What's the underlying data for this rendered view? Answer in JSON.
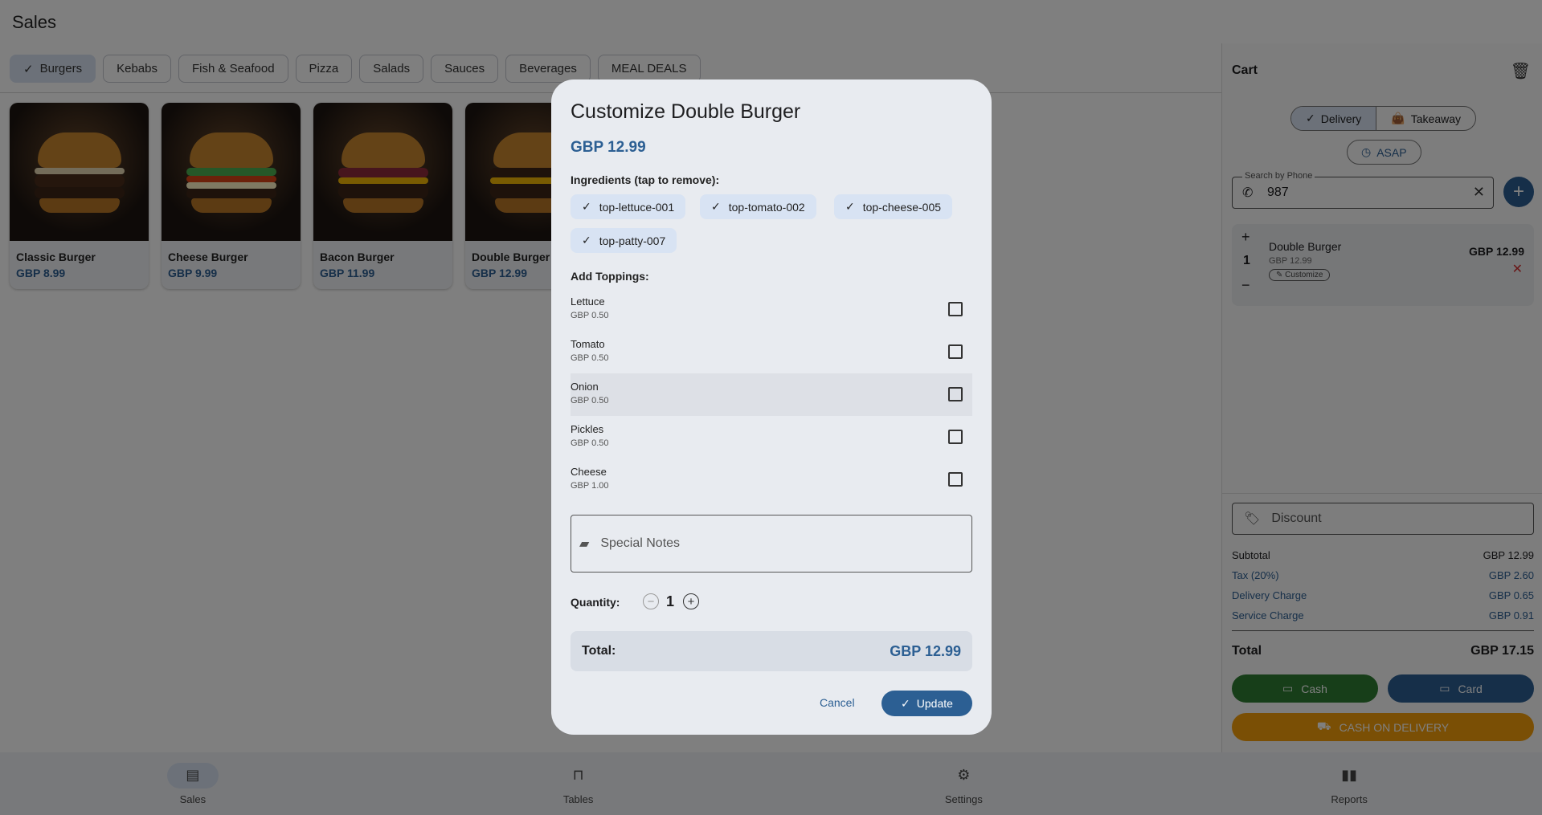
{
  "header": {
    "title": "Sales"
  },
  "categories": [
    {
      "label": "Burgers",
      "selected": true
    },
    {
      "label": "Kebabs"
    },
    {
      "label": "Fish & Seafood"
    },
    {
      "label": "Pizza"
    },
    {
      "label": "Salads"
    },
    {
      "label": "Sauces"
    },
    {
      "label": "Beverages"
    },
    {
      "label": "MEAL DEALS"
    }
  ],
  "products": [
    {
      "name": "Classic Burger",
      "price": "GBP 8.99"
    },
    {
      "name": "Cheese Burger",
      "price": "GBP 9.99"
    },
    {
      "name": "Bacon Burger",
      "price": "GBP 11.99"
    },
    {
      "name": "Double Burger",
      "price": "GBP 12.99"
    }
  ],
  "cart": {
    "title": "Cart",
    "order_types": [
      {
        "label": "Delivery",
        "selected": true
      },
      {
        "label": "Takeaway"
      }
    ],
    "asap_label": "ASAP",
    "phone": {
      "label": "Search by Phone",
      "value": "987"
    },
    "items": [
      {
        "qty": "1",
        "name": "Double Burger",
        "unit_price": "GBP 12.99",
        "customize_label": "Customize",
        "line_total": "GBP 12.99"
      }
    ],
    "discount_placeholder": "Discount",
    "summary": {
      "subtotal_label": "Subtotal",
      "subtotal": "GBP 12.99",
      "tax_label": "Tax (20%)",
      "tax": "GBP 2.60",
      "delivery_label": "Delivery Charge",
      "delivery": "GBP 0.65",
      "service_label": "Service Charge",
      "service": "GBP 0.91",
      "total_label": "Total",
      "total": "GBP 17.15"
    },
    "pay": {
      "cash": "Cash",
      "card": "Card",
      "cod": "CASH ON DELIVERY"
    }
  },
  "nav": [
    {
      "label": "Sales",
      "icon": "register-icon",
      "selected": true
    },
    {
      "label": "Tables",
      "icon": "table-icon"
    },
    {
      "label": "Settings",
      "icon": "gear-icon"
    },
    {
      "label": "Reports",
      "icon": "bar-chart-icon"
    }
  ],
  "modal": {
    "title": "Customize Double Burger",
    "price": "GBP 12.99",
    "ingredients_label": "Ingredients (tap to remove):",
    "ingredients": [
      "top-lettuce-001",
      "top-tomato-002",
      "top-cheese-005",
      "top-patty-007"
    ],
    "toppings_label": "Add Toppings:",
    "toppings": [
      {
        "name": "Lettuce",
        "price": "GBP 0.50",
        "checked": false
      },
      {
        "name": "Tomato",
        "price": "GBP 0.50",
        "checked": false
      },
      {
        "name": "Onion",
        "price": "GBP 0.50",
        "checked": false
      },
      {
        "name": "Pickles",
        "price": "GBP 0.50",
        "checked": false
      },
      {
        "name": "Cheese",
        "price": "GBP 1.00",
        "checked": false
      }
    ],
    "notes_placeholder": "Special Notes",
    "quantity_label": "Quantity:",
    "quantity": "1",
    "total_label": "Total:",
    "total": "GBP 12.99",
    "cancel_label": "Cancel",
    "update_label": "Update"
  },
  "colors": {
    "accent": "#2c5f93",
    "chip_selected": "#d8e3f3",
    "cash": "#2e7d32",
    "cod": "#f59e0b",
    "remove": "#d32f2f"
  }
}
